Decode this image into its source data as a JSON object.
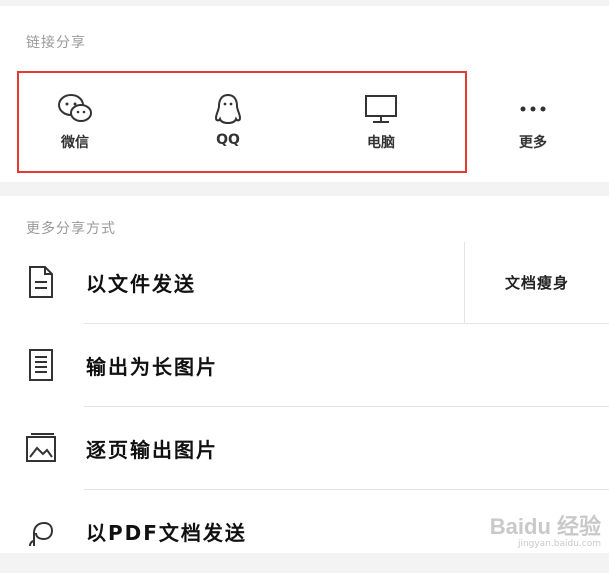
{
  "link_share": {
    "title": "链接分享",
    "items": [
      {
        "label": "微信",
        "icon": "wechat-icon"
      },
      {
        "label": "QQ",
        "icon": "qq-penguin-icon"
      },
      {
        "label": "电脑",
        "icon": "computer-monitor-icon"
      },
      {
        "label": "更多",
        "icon": "more-dots-icon"
      }
    ],
    "highlight_color": "#e53935"
  },
  "more_share": {
    "title": "更多分享方式",
    "rows": [
      {
        "label": "以文件发送",
        "icon": "document-icon",
        "extra_button": "文档瘦身"
      },
      {
        "label": "输出为长图片",
        "icon": "long-image-icon"
      },
      {
        "label": "逐页输出图片",
        "icon": "picture-icon"
      },
      {
        "label": "以PDF文档发送",
        "icon": "pdf-icon"
      }
    ]
  },
  "watermark": {
    "brand": "Baidu 经验",
    "url": "jingyan.baidu.com"
  }
}
